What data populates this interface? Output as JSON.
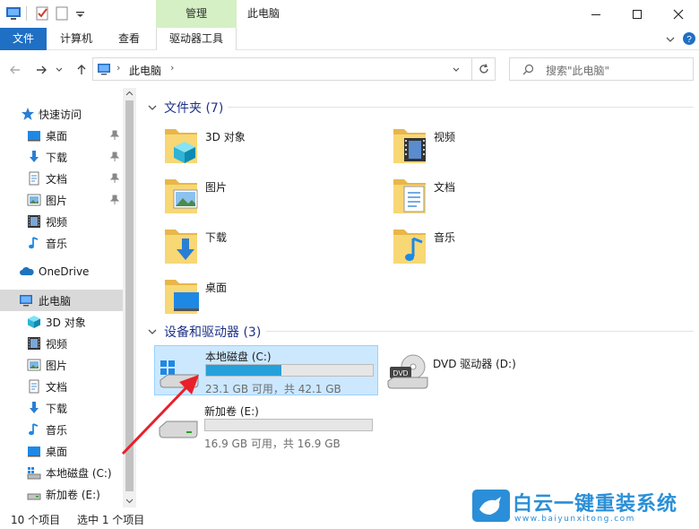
{
  "titlebar": {
    "manage_label": "管理",
    "title": "此电脑"
  },
  "ribbon": {
    "tabs": [
      "文件",
      "计算机",
      "查看",
      "驱动器工具"
    ]
  },
  "address": {
    "path_item": "此电脑",
    "search_placeholder": "搜索\"此电脑\""
  },
  "nav": {
    "quick_access": "快速访问",
    "quick_items": [
      "桌面",
      "下载",
      "文档",
      "图片",
      "视频",
      "音乐"
    ],
    "onedrive": "OneDrive",
    "this_pc": "此电脑",
    "pc_items": [
      "3D 对象",
      "视频",
      "图片",
      "文档",
      "下载",
      "音乐",
      "桌面",
      "本地磁盘 (C:)",
      "新加卷 (E:)"
    ]
  },
  "content": {
    "folders_header": "文件夹 (7)",
    "folders": [
      "3D 对象",
      "视频",
      "图片",
      "文档",
      "下载",
      "音乐",
      "桌面"
    ],
    "devices_header": "设备和驱动器 (3)",
    "drives": [
      {
        "name": "本地磁盘 (C:)",
        "info": "23.1 GB 可用，共 42.1 GB",
        "used_fraction": 0.45
      },
      {
        "name": "DVD 驱动器 (D:)"
      },
      {
        "name": "新加卷 (E:)",
        "info": "16.9 GB 可用，共 16.9 GB",
        "used_fraction": 0.0
      }
    ]
  },
  "status": {
    "count": "10 个项目",
    "selected": "选中 1 个项目"
  },
  "watermark": {
    "brand": "白云一键重装系统",
    "url": "www.baiyunxitong.com"
  },
  "colors": {
    "accent": "#1f6fc5",
    "manage_tab": "#d4f0c4",
    "selection": "#cce8ff",
    "drive_fill": "#26a0da",
    "group_header": "#1e3287",
    "arrow": "#e8202a"
  }
}
